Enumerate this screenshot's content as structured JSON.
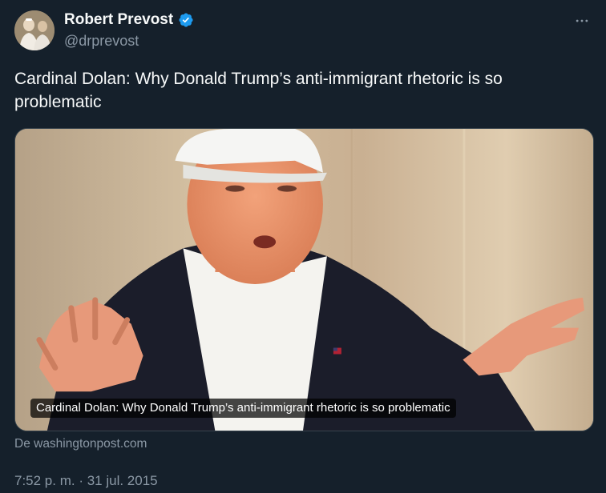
{
  "author": {
    "name": "Robert Prevost",
    "handle": "@drprevost",
    "verified": true,
    "verified_color": "#1d9bf0"
  },
  "tweet": {
    "text": "Cardinal Dolan: Why Donald Trump’s anti-immigrant rhetoric is so problematic",
    "timestamp": "7:52 p. m. · 31 jul. 2015"
  },
  "card": {
    "caption": "Cardinal Dolan: Why Donald Trump’s anti-immigrant rhetoric is so problematic",
    "source": "De washingtonpost.com"
  },
  "icons": {
    "more": "more-icon",
    "verified": "verified-badge-icon"
  },
  "theme": {
    "background": "#15202b",
    "secondary_text": "#8b98a5"
  }
}
